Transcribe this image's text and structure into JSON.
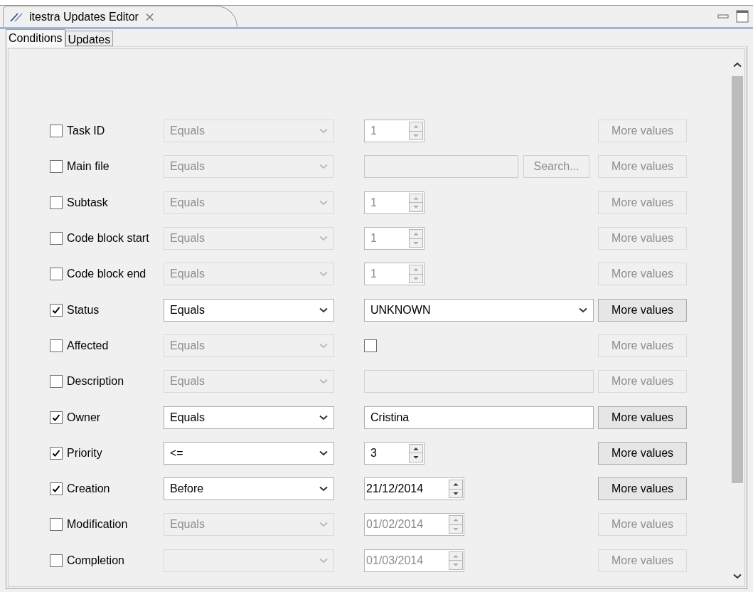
{
  "editor_tab": {
    "title": "itestra Updates Editor",
    "close": "⨯"
  },
  "tabs": [
    {
      "label": "Conditions",
      "selected": true
    },
    {
      "label": "Updates",
      "selected": false
    }
  ],
  "conditions": [
    {
      "label": "Task ID",
      "checked": false,
      "operator": "Equals",
      "value": {
        "kind": "spinner",
        "text": "1"
      },
      "more": "More values"
    },
    {
      "label": "Main file",
      "checked": false,
      "operator": "Equals",
      "value": {
        "kind": "file",
        "button": "Search..."
      },
      "more": "More values"
    },
    {
      "label": "Subtask",
      "checked": false,
      "operator": "Equals",
      "value": {
        "kind": "spinner",
        "text": "1"
      },
      "more": "More values"
    },
    {
      "label": "Code block start",
      "checked": false,
      "operator": "Equals",
      "value": {
        "kind": "spinner",
        "text": "1"
      },
      "more": "More values"
    },
    {
      "label": "Code block end",
      "checked": false,
      "operator": "Equals",
      "value": {
        "kind": "spinner",
        "text": "1"
      },
      "more": "More values"
    },
    {
      "label": "Status",
      "checked": true,
      "operator": "Equals",
      "value": {
        "kind": "dropdown",
        "text": "UNKNOWN"
      },
      "more": "More values"
    },
    {
      "label": "Affected",
      "checked": false,
      "operator": "Equals",
      "value": {
        "kind": "checkbox",
        "checked": false
      },
      "more": "More values"
    },
    {
      "label": "Description",
      "checked": false,
      "operator": "Equals",
      "value": {
        "kind": "text"
      },
      "more": "More values"
    },
    {
      "label": "Owner",
      "checked": true,
      "operator": "Equals",
      "value": {
        "kind": "text",
        "text": "Cristina"
      },
      "more": "More values"
    },
    {
      "label": "Priority",
      "checked": true,
      "operator": "<=",
      "value": {
        "kind": "spinner",
        "text": "3"
      },
      "more": "More values"
    },
    {
      "label": "Creation",
      "checked": true,
      "operator": "Before",
      "value": {
        "kind": "date",
        "text": "21/12/2014"
      },
      "more": "More values"
    },
    {
      "label": "Modification",
      "checked": false,
      "operator": "Equals",
      "value": {
        "kind": "date",
        "text": "01/02/2014"
      },
      "more": "More values"
    },
    {
      "label": "Completion",
      "checked": false,
      "value": {
        "kind": "date",
        "text": "01/03/2014"
      },
      "more": "More values"
    }
  ]
}
